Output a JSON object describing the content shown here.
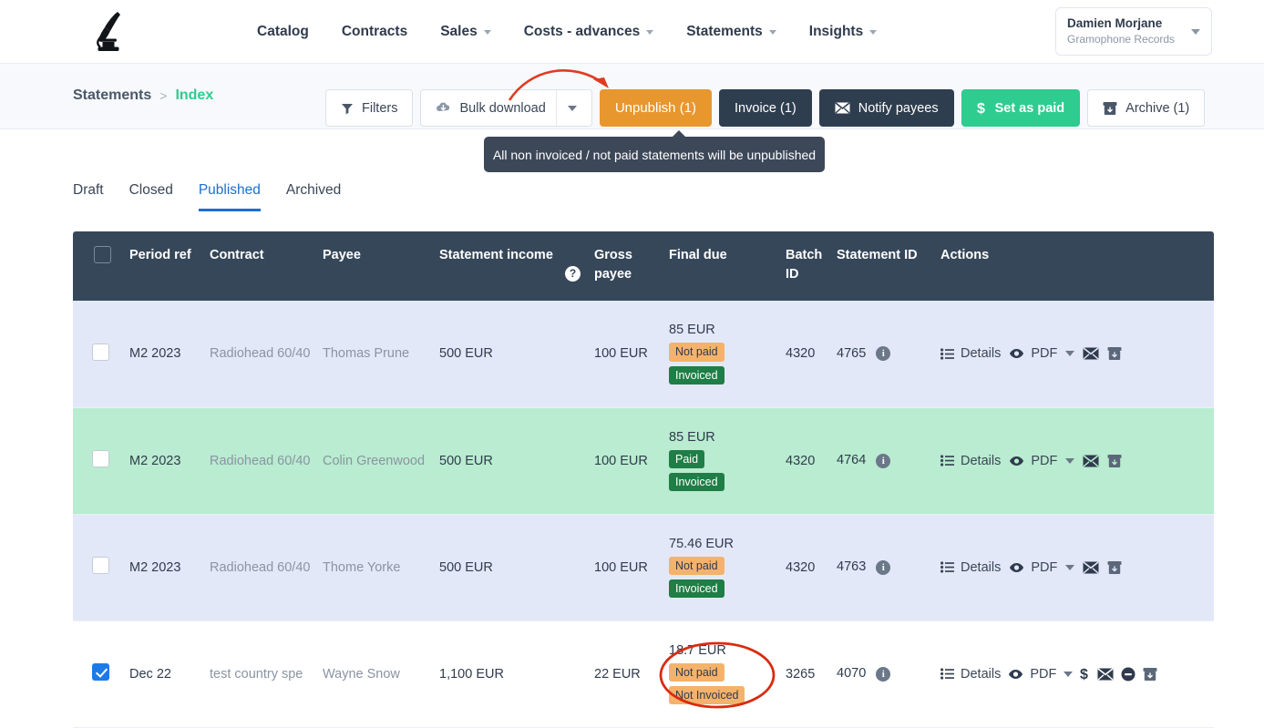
{
  "nav": {
    "logo_icon": "gramophone-logo-icon",
    "items": [
      {
        "label": "Catalog",
        "has_dropdown": false
      },
      {
        "label": "Contracts",
        "has_dropdown": false
      },
      {
        "label": "Sales",
        "has_dropdown": true
      },
      {
        "label": "Costs - advances",
        "has_dropdown": true
      },
      {
        "label": "Statements",
        "has_dropdown": true
      },
      {
        "label": "Insights",
        "has_dropdown": true
      }
    ],
    "account": {
      "name": "Damien Morjane",
      "org": "Gramophone Records"
    }
  },
  "breadcrumb": {
    "root": "Statements",
    "separator": ">",
    "current": "Index"
  },
  "toolbar": {
    "filters_label": "Filters",
    "bulk_download_label": "Bulk download",
    "unpublish_label": "Unpublish (1)",
    "invoice_label": "Invoice (1)",
    "notify_label": "Notify payees",
    "set_as_paid_label": "Set as paid",
    "archive_label": "Archive (1)",
    "tooltip": "All non invoiced / not paid statements will be unpublished",
    "accent_orange": "#e8972e",
    "accent_green": "#2ecc8f",
    "accent_dark": "#2f3e4f"
  },
  "tabs": [
    {
      "label": "Draft",
      "active": false
    },
    {
      "label": "Closed",
      "active": false
    },
    {
      "label": "Published",
      "active": true
    },
    {
      "label": "Archived",
      "active": false
    }
  ],
  "table": {
    "columns": [
      "Period ref",
      "Contract",
      "Payee",
      "Statement income",
      "Gross payee",
      "Final due",
      "Batch ID",
      "Statement ID",
      "Actions"
    ],
    "help_icon_tooltip": "?",
    "rows": [
      {
        "selected": false,
        "row_style": "lavender",
        "period_ref": "M2 2023",
        "contract": "Radiohead 60/40",
        "payee": "Thomas Prune",
        "statement_income": "500 EUR",
        "gross_payee": "100 EUR",
        "final_due": "85 EUR",
        "badges": [
          {
            "label": "Not paid",
            "tone": "orange"
          },
          {
            "label": "Invoiced",
            "tone": "green"
          }
        ],
        "batch_id": "4320",
        "statement_id": "4765",
        "actions": {
          "details_label": "Details",
          "pdf_label": "PDF",
          "icons": [
            "list-icon",
            "eye-icon",
            "caret-down-icon",
            "envelope-icon",
            "archive-icon"
          ]
        }
      },
      {
        "selected": false,
        "row_style": "green",
        "period_ref": "M2 2023",
        "contract": "Radiohead 60/40",
        "payee": "Colin Greenwood",
        "statement_income": "500 EUR",
        "gross_payee": "100 EUR",
        "final_due": "85 EUR",
        "badges": [
          {
            "label": "Paid",
            "tone": "green"
          },
          {
            "label": "Invoiced",
            "tone": "green"
          }
        ],
        "batch_id": "4320",
        "statement_id": "4764",
        "actions": {
          "details_label": "Details",
          "pdf_label": "PDF",
          "icons": [
            "list-icon",
            "eye-icon",
            "caret-down-icon",
            "envelope-icon",
            "archive-icon"
          ]
        }
      },
      {
        "selected": false,
        "row_style": "lavender",
        "period_ref": "M2 2023",
        "contract": "Radiohead 60/40",
        "payee": "Thome Yorke",
        "statement_income": "500 EUR",
        "gross_payee": "100 EUR",
        "final_due": "75.46 EUR",
        "badges": [
          {
            "label": "Not paid",
            "tone": "orange"
          },
          {
            "label": "Invoiced",
            "tone": "green"
          }
        ],
        "batch_id": "4320",
        "statement_id": "4763",
        "actions": {
          "details_label": "Details",
          "pdf_label": "PDF",
          "icons": [
            "list-icon",
            "eye-icon",
            "caret-down-icon",
            "envelope-icon",
            "archive-icon"
          ]
        }
      },
      {
        "selected": true,
        "row_style": "white",
        "period_ref": "Dec 22",
        "contract": "test country spe",
        "payee": "Wayne Snow",
        "statement_income": "1,100 EUR",
        "gross_payee": "22 EUR",
        "final_due": "18.7 EUR",
        "badges": [
          {
            "label": "Not paid",
            "tone": "orange"
          },
          {
            "label": "Not Invoiced",
            "tone": "orange"
          }
        ],
        "batch_id": "3265",
        "statement_id": "4070",
        "actions": {
          "details_label": "Details",
          "pdf_label": "PDF",
          "icons": [
            "list-icon",
            "eye-icon",
            "caret-down-icon",
            "dollar-icon",
            "envelope-icon",
            "minus-circle-icon",
            "archive-icon"
          ]
        }
      }
    ]
  },
  "annotations": {
    "arrow_color": "#e03b20",
    "ellipse_color": "#d92b0e"
  }
}
